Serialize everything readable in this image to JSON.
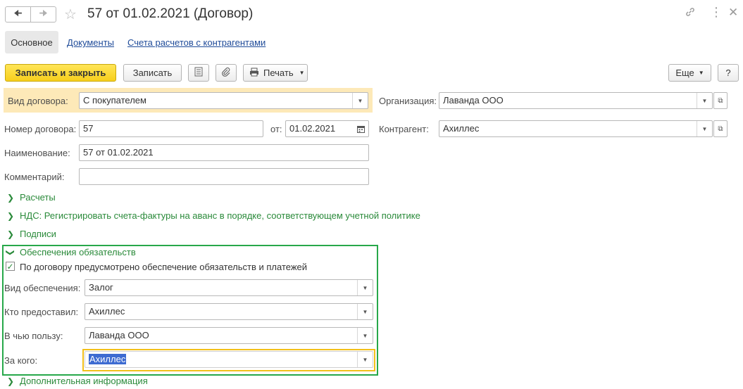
{
  "window": {
    "title": "57 от 01.02.2021 (Договор)"
  },
  "tabs": [
    {
      "label": "Основное",
      "active": true
    },
    {
      "label": "Документы"
    },
    {
      "label": "Счета расчетов с контрагентами"
    }
  ],
  "toolbar": {
    "save_close": "Записать и закрыть",
    "save": "Записать",
    "print": "Печать",
    "more": "Еще",
    "help": "?"
  },
  "form": {
    "contract_type": {
      "label": "Вид договора:",
      "value": "С покупателем"
    },
    "organization": {
      "label": "Организация:",
      "value": "Лаванда ООО"
    },
    "number": {
      "label": "Номер договора:",
      "value": "57"
    },
    "date": {
      "label": "от:",
      "value": "01.02.2021"
    },
    "counterparty": {
      "label": "Контрагент:",
      "value": "Ахиллес"
    },
    "name": {
      "label": "Наименование:",
      "value": "57 от 01.02.2021"
    },
    "comment": {
      "label": "Комментарий:",
      "value": ""
    }
  },
  "groups": {
    "settlements": "Расчеты",
    "vat": "НДС: Регистрировать счета-фактуры на аванс в порядке, соответствующем учетной политике",
    "signatures": "Подписи",
    "security": "Обеспечения обязательств",
    "additional": "Дополнительная информация"
  },
  "security": {
    "checkbox_label": "По договору предусмотрено обеспечение обязательств и платежей",
    "checked": true,
    "kind": {
      "label": "Вид обеспечения:",
      "value": "Залог"
    },
    "provided_by": {
      "label": "Кто предоставил:",
      "value": "Ахиллес"
    },
    "beneficiary": {
      "label": "В чью пользу:",
      "value": "Лаванда ООО"
    },
    "for_whom": {
      "label": "За кого:",
      "value": "Ахиллес"
    }
  },
  "colors": {
    "accent_yellow": "#f7cf1c",
    "group_green": "#2a8a3a",
    "frame_green": "#27a84a",
    "highlight_label_bg": "#fde9b8",
    "selection_blue": "#3d6bd1"
  }
}
